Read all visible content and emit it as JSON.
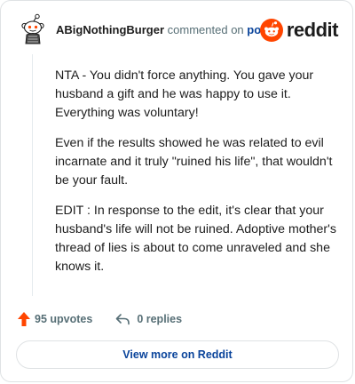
{
  "header": {
    "author": "ABigNothingBurger",
    "verb": "commented on",
    "post_link": "post",
    "brand": "reddit"
  },
  "comment": {
    "paragraphs": [
      "NTA - You didn't force anything. You gave your husband a gift and he was happy to use it. Everything was voluntary!",
      "Even if the results showed he was related to evil incarnate and it truly \"ruined his life\", that wouldn't be your fault.",
      "EDIT : In response to the edit, it's clear that your husband's life will not be ruined. Adoptive mother's thread of lies is about to come unraveled and she knows it."
    ]
  },
  "actions": {
    "upvotes": "95 upvotes",
    "replies": "0 replies"
  },
  "footer": {
    "view_more": "View more on Reddit"
  },
  "colors": {
    "brand_orange": "#ff4500",
    "link_blue": "#0a449b",
    "muted": "#576f76",
    "border": "#dfe2e4"
  },
  "icons": {
    "avatar": "snoo-avatar",
    "brand": "reddit-logo-icon",
    "upvote": "upvote-arrow-icon",
    "reply": "reply-arrow-icon"
  }
}
